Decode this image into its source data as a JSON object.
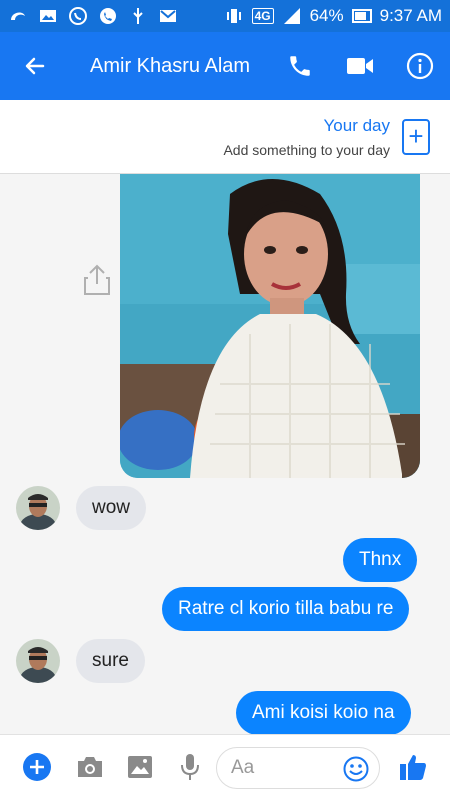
{
  "status_bar": {
    "battery": "64%",
    "time": "9:37 AM",
    "network": "4G"
  },
  "header": {
    "title": "Amir Khasru Alam",
    "icons": [
      "back-arrow-icon",
      "phone-icon",
      "video-icon",
      "info-icon"
    ]
  },
  "your_day": {
    "title": "Your day",
    "subtitle": "Add something to your day"
  },
  "messages": [
    {
      "direction": "incoming",
      "text": "wow"
    },
    {
      "direction": "outgoing",
      "text": "Thnx"
    },
    {
      "direction": "outgoing",
      "text": "Ratre cl korio tilla babu re"
    },
    {
      "direction": "incoming",
      "text": "sure"
    },
    {
      "direction": "outgoing",
      "text": "Ami koisi koio na"
    }
  ],
  "composer": {
    "placeholder": "Aa"
  },
  "colors": {
    "brand": "#1877f2",
    "outgoing_bubble": "#0b84ff",
    "incoming_bubble": "#e4e6eb"
  }
}
